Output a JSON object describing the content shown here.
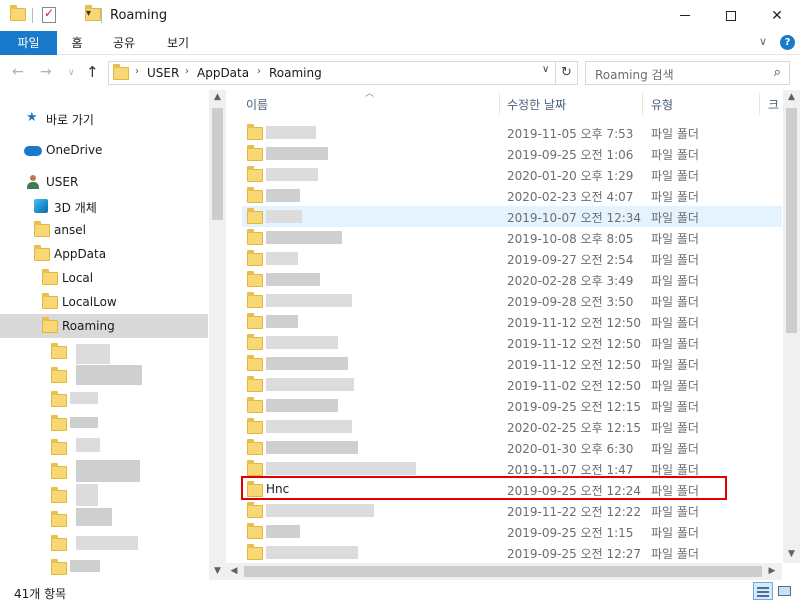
{
  "window": {
    "title": "Roaming",
    "minimize_glyph": "",
    "close_glyph": "✕",
    "qa_dropdown": "▾"
  },
  "ribbon": {
    "tabs": [
      "파일",
      "홈",
      "공유",
      "보기"
    ],
    "expand_glyph": "∨",
    "help_glyph": "?"
  },
  "address_bar": {
    "breadcrumbs": [
      "USER",
      "AppData",
      "Roaming"
    ],
    "separator_glyph": "›",
    "dropdown_glyph": "∨",
    "refresh_glyph": "↻"
  },
  "search": {
    "placeholder": "Roaming 검색",
    "icon": "search-icon"
  },
  "nav_pane": {
    "items": [
      {
        "label": "바로 가기",
        "icon": "star-icon"
      },
      {
        "label": "OneDrive",
        "icon": "cloud-icon"
      },
      {
        "label": "USER",
        "icon": "user-icon"
      },
      {
        "label": "3D 개체",
        "icon": "cube-icon"
      },
      {
        "label": "ansel",
        "icon": "folder-icon"
      },
      {
        "label": "AppData",
        "icon": "folder-icon"
      },
      {
        "label": "Local",
        "icon": "folder-icon"
      },
      {
        "label": "LocalLow",
        "icon": "folder-icon"
      },
      {
        "label": "Roaming",
        "icon": "folder-icon",
        "selected": true
      }
    ]
  },
  "file_list": {
    "columns": {
      "name": "이름",
      "modified": "수정한 날짜",
      "type": "유형",
      "size": "크"
    },
    "rows": [
      {
        "name": "",
        "modified": "2019-11-05 오후 7:53",
        "type": "파일 폴더"
      },
      {
        "name": "",
        "modified": "2019-09-25 오전 1:06",
        "type": "파일 폴더"
      },
      {
        "name": "",
        "modified": "2020-01-20 오후 1:29",
        "type": "파일 폴더"
      },
      {
        "name": "",
        "modified": "2020-02-23 오전 4:07",
        "type": "파일 폴더"
      },
      {
        "name": "",
        "modified": "2019-10-07 오전 12:34",
        "type": "파일 폴더",
        "hover": true
      },
      {
        "name": "",
        "modified": "2019-10-08 오후 8:05",
        "type": "파일 폴더"
      },
      {
        "name": "",
        "modified": "2019-09-27 오전 2:54",
        "type": "파일 폴더"
      },
      {
        "name": "",
        "modified": "2020-02-28 오후 3:49",
        "type": "파일 폴더"
      },
      {
        "name": "",
        "modified": "2019-09-28 오전 3:50",
        "type": "파일 폴더"
      },
      {
        "name": "",
        "modified": "2019-11-12 오전 12:50",
        "type": "파일 폴더"
      },
      {
        "name": "",
        "modified": "2019-11-12 오전 12:50",
        "type": "파일 폴더"
      },
      {
        "name": "",
        "modified": "2019-11-12 오전 12:50",
        "type": "파일 폴더"
      },
      {
        "name": "",
        "modified": "2019-11-02 오전 12:50",
        "type": "파일 폴더"
      },
      {
        "name": "",
        "modified": "2019-09-25 오전 12:15",
        "type": "파일 폴더"
      },
      {
        "name": "",
        "modified": "2020-02-25 오후 12:15",
        "type": "파일 폴더"
      },
      {
        "name": "",
        "modified": "2020-01-30 오후 6:30",
        "type": "파일 폴더"
      },
      {
        "name": "",
        "modified": "2019-11-07 오전 1:47",
        "type": "파일 폴더"
      },
      {
        "name": "Hnc",
        "modified": "2019-09-25 오전 12:24",
        "type": "파일 폴더",
        "highlighted": true
      },
      {
        "name": "",
        "modified": "2019-11-22 오전 12:22",
        "type": "파일 폴더"
      },
      {
        "name": "",
        "modified": "2019-09-25 오전 1:15",
        "type": "파일 폴더"
      },
      {
        "name": "",
        "modified": "2019-09-25 오전 12:27",
        "type": "파일 폴더"
      }
    ]
  },
  "status_bar": {
    "item_count": "41개 항목"
  },
  "colors": {
    "accent": "#1979ca",
    "selection": "#d9d9d9",
    "hover_row": "#e5f3ff",
    "highlight_border": "#e00000",
    "folder": "#f8d775"
  }
}
